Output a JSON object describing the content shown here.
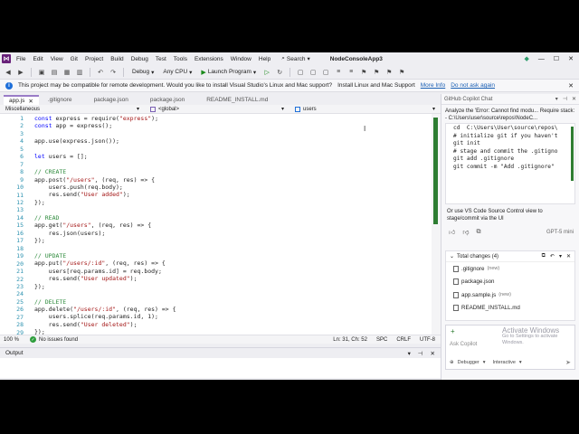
{
  "app": {
    "project_name": "NodeConsoleApp3",
    "menu": [
      "File",
      "Edit",
      "View",
      "Git",
      "Project",
      "Build",
      "Debug",
      "Test",
      "Tools",
      "Extensions",
      "Window",
      "Help"
    ],
    "search_label": "Search"
  },
  "toolbar": {
    "config": "Debug",
    "platform": "Any CPU",
    "launch_label": "Launch Program"
  },
  "infobar": {
    "message": "This project may be compatible for remote development. Would you like to install Visual Studio's Linux and Mac support?",
    "action_install": "Install Linux and Mac Support",
    "action_more": "More Info",
    "action_dismiss": "Do not ask again"
  },
  "tabs": [
    {
      "label": "app.js",
      "active": true
    },
    {
      "label": ".gitignore",
      "active": false
    },
    {
      "label": "package.json",
      "active": false
    },
    {
      "label": "package.json",
      "active": false
    },
    {
      "label": "README_INSTALL.md",
      "active": false
    }
  ],
  "navbar": {
    "project": "Miscellaneous",
    "scope": "<global>",
    "member": "users"
  },
  "code": {
    "lines": [
      "const express = require(\"express\");",
      "const app = express();",
      "",
      "app.use(express.json());",
      "",
      "let users = [];",
      "",
      "// CREATE",
      "app.post(\"/users\", (req, res) => {",
      "    users.push(req.body);",
      "    res.send(\"User added\");",
      "});",
      "",
      "// READ",
      "app.get(\"/users\", (req, res) => {",
      "    res.json(users);",
      "});",
      "",
      "// UPDATE",
      "app.put(\"/users/:id\", (req, res) => {",
      "    users[req.params.id] = req.body;",
      "    res.send(\"User updated\");",
      "});",
      "",
      "// DELETE",
      "app.delete(\"/users/:id\", (req, res) => {",
      "    users.splice(req.params.id, 1);",
      "    res.send(\"User deleted\");",
      "});"
    ]
  },
  "status": {
    "zoom": "100 %",
    "issues": "No issues found",
    "position": "Ln: 31, Ch: 52",
    "whitespace": "SPC",
    "eol": "CRLF",
    "encoding": "UTF-8"
  },
  "output": {
    "title": "Output"
  },
  "chat": {
    "title": "GitHub Copilot Chat",
    "question": "Analyze the 'Error: Cannot find modu... Require stack: - C:\\Users\\user\\source\\repos\\NodeC...",
    "snippet": [
      "cd  C:\\Users\\User\\source\\repos\\",
      "",
      "# initialize git if you haven't",
      "git init",
      "",
      "# stage and commit the .gitigno",
      "git add .gitignore",
      "git commit -m \"Add .gitignore\""
    ],
    "text": "Or use VS Code Source Control view to stage/commit via the UI",
    "model": "GPT-5 mini",
    "changes_title": "Total changes (4)",
    "changes": [
      {
        "name": ".gitignore",
        "tag": "(new)"
      },
      {
        "name": "package.json",
        "tag": ""
      },
      {
        "name": "app.sample.js",
        "tag": "(new)"
      },
      {
        "name": "README_INSTALL.md",
        "tag": ""
      }
    ],
    "input_placeholder": "Ask Copilot",
    "debugger_label": "Debugger",
    "mode_label": "Interactive",
    "watermark_title": "Activate Windows",
    "watermark_sub": "Go to Settings to activate Windows."
  }
}
